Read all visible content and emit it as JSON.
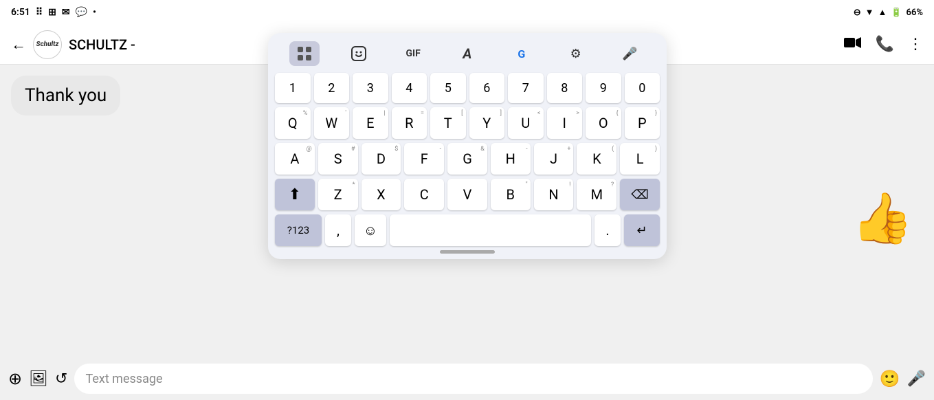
{
  "status_bar": {
    "time": "6:51",
    "battery": "66%"
  },
  "header": {
    "contact_name": "SCHULTZ -",
    "back_label": "←",
    "video_icon": "video-camera",
    "phone_icon": "phone",
    "more_icon": "more-vertical"
  },
  "chat": {
    "message": "Thank you",
    "thumbs_up_emoji": "👍"
  },
  "input_bar": {
    "placeholder": "Text message",
    "add_icon": "plus-circle",
    "media_icon": "image",
    "refresh_icon": "refresh",
    "emoji_icon": "emoji",
    "mic_icon": "microphone"
  },
  "keyboard": {
    "toolbar": {
      "grid_icon": "grid",
      "sticker_icon": "sticker",
      "gif_label": "GIF",
      "font_icon": "font",
      "translate_icon": "translate",
      "settings_icon": "settings",
      "mic_icon": "microphone"
    },
    "number_row": [
      "1",
      "2",
      "3",
      "4",
      "5",
      "6",
      "7",
      "8",
      "9",
      "0"
    ],
    "row1": {
      "keys": [
        "Q",
        "W",
        "E",
        "R",
        "T",
        "Y",
        "U",
        "I",
        "O",
        "P"
      ],
      "supers": [
        "",
        "'",
        "",
        "=",
        "[",
        "]",
        "<",
        ">",
        "{",
        "}"
      ]
    },
    "row2": {
      "keys": [
        "A",
        "S",
        "D",
        "F",
        "G",
        "H",
        "J",
        "K",
        "L"
      ],
      "supers": [
        "@",
        "#",
        "$",
        "-",
        "&",
        "-",
        "+",
        "(",
        "("
      ]
    },
    "row3": {
      "keys": [
        "Z",
        "X",
        "C",
        "V",
        "B",
        "N",
        "M"
      ],
      "supers": [
        "*",
        "",
        "",
        "",
        "\"",
        "!",
        "?"
      ]
    },
    "bottom_row": {
      "numbers_label": "?123",
      "comma_label": ",",
      "emoji_label": "☺",
      "space_label": "",
      "period_label": ".",
      "enter_label": "↵"
    }
  }
}
